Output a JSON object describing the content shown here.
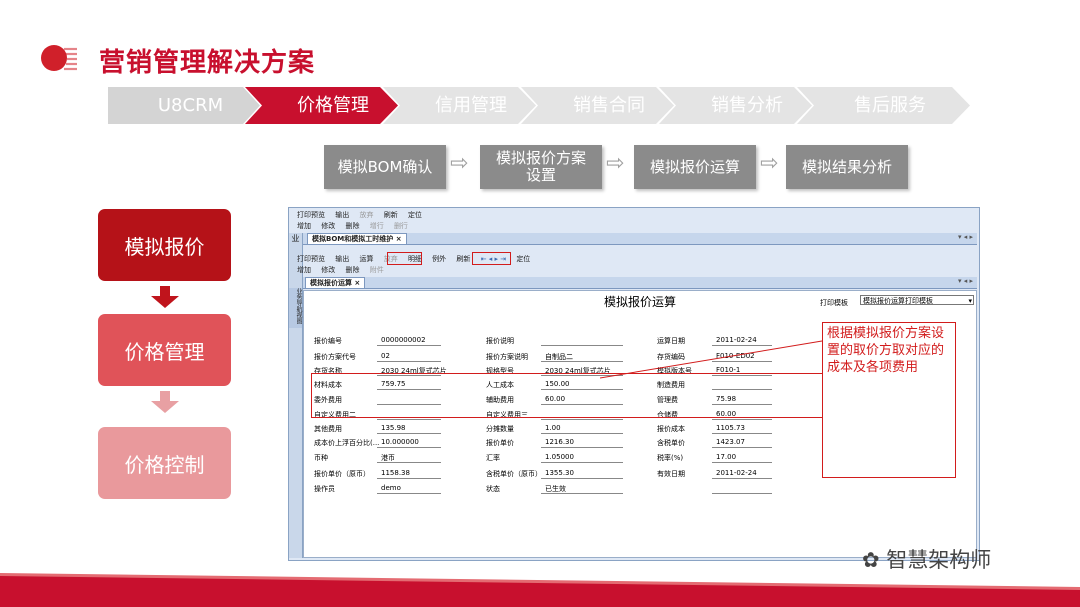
{
  "page": {
    "title": "营销管理解决方案",
    "accent": "#c8102e"
  },
  "nav": {
    "items": [
      {
        "label": "U8CRM",
        "active": false
      },
      {
        "label": "价格管理",
        "active": true
      },
      {
        "label": "信用管理",
        "active": false
      },
      {
        "label": "销售合同",
        "active": false
      },
      {
        "label": "销售分析",
        "active": false
      },
      {
        "label": "售后服务",
        "active": false
      }
    ]
  },
  "process": {
    "steps": [
      "模拟BOM确认",
      "模拟报价方案设置",
      "模拟报价运算",
      "模拟结果分析"
    ]
  },
  "stages": [
    {
      "label": "模拟报价",
      "color": "#b51218"
    },
    {
      "label": "价格管理",
      "color": "#e05359"
    },
    {
      "label": "价格控制",
      "color": "#e9999c"
    }
  ],
  "window": {
    "toolbar1": [
      "打印预览",
      "输出",
      "放弃",
      "刷新",
      "定位"
    ],
    "toolbar2": [
      "增加",
      "修改",
      "删除",
      "增行",
      "删行"
    ],
    "outer_tab": "模拟BOM和模拟工时维护",
    "side_label": "业",
    "side_label2": "业务导航视图",
    "toolbar3": [
      "打印预览",
      "输出",
      "运算",
      "放弃",
      "明细",
      "例外",
      "刷新",
      "定位"
    ],
    "toolbar4": [
      "增加",
      "修改",
      "删除",
      "附件"
    ],
    "inner_tab": "模拟报价运算",
    "tab_ctrl": "▾ ◂ ▸",
    "form_title": "模拟报价运算",
    "print_template_label": "打印模板",
    "print_template_value": "模拟报价运算打印模板",
    "fields": {
      "r1": [
        [
          "报价编号",
          "0000000002"
        ],
        [
          "报价说明",
          ""
        ],
        [
          "运算日期",
          "2011-02-24"
        ]
      ],
      "r2": [
        [
          "报价方案代号",
          "02"
        ],
        [
          "报价方案说明",
          "自制品二"
        ],
        [
          "存货编码",
          "F010-ED02"
        ]
      ],
      "r3": [
        [
          "存货名称",
          "2030 24ml复式芯片"
        ],
        [
          "规格型号",
          "2030 24ml复式芯片"
        ],
        [
          "模拟版本号",
          "F010-1"
        ]
      ],
      "r4": [
        [
          "材料成本",
          "759.75"
        ],
        [
          "人工成本",
          "150.00"
        ],
        [
          "制造费用",
          ""
        ]
      ],
      "r5": [
        [
          "委外费用",
          ""
        ],
        [
          "辅助费用",
          "60.00"
        ],
        [
          "管理费",
          "75.98"
        ]
      ],
      "r6": [
        [
          "自定义费用二",
          ""
        ],
        [
          "自定义费用三",
          ""
        ],
        [
          "仓储费",
          "60.00"
        ]
      ],
      "r7": [
        [
          "其他费用",
          "135.98"
        ],
        [
          "分摊数量",
          "1.00"
        ],
        [
          "报价成本",
          "1105.73"
        ]
      ],
      "r8": [
        [
          "成本价上浮百分比(...",
          "10.000000"
        ],
        [
          "报价单价",
          "1216.30"
        ],
        [
          "含税单价",
          "1423.07"
        ]
      ],
      "r9": [
        [
          "币种",
          "港币"
        ],
        [
          "汇率",
          "1.05000"
        ],
        [
          "税率(%)",
          "17.00"
        ]
      ],
      "r10": [
        [
          "报价单价（原币）",
          "1158.38"
        ],
        [
          "含税单价（原币）",
          "1355.30"
        ],
        [
          "有效日期",
          "2011-02-24"
        ]
      ],
      "r11": [
        [
          "操作员",
          "demo"
        ],
        [
          "状态",
          "已生效"
        ],
        [
          "",
          ""
        ]
      ]
    }
  },
  "callout": {
    "text": "根据模拟报价方案设置的取价方取对应的成本及各项费用"
  },
  "watermark": {
    "text": "智慧架构师"
  }
}
